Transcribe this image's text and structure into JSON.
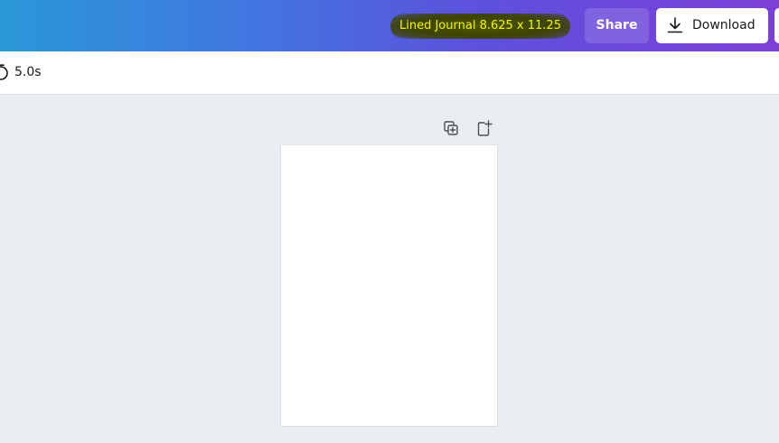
{
  "header": {
    "doc_title": "Lined Journal 8.625 x 11.25",
    "share_label": "Share",
    "download_label": "Download",
    "download_icon": "download-arrow-icon"
  },
  "toolbar": {
    "timer_icon": "timer-icon",
    "timer_value": "5.0s"
  },
  "canvas": {
    "tools": [
      {
        "icon": "duplicate-page-icon"
      },
      {
        "icon": "add-page-icon"
      }
    ]
  },
  "colors": {
    "header_gradient_start": "#2a98d8",
    "header_gradient_end": "#7d3fd8",
    "title_highlight_text": "#f2f500",
    "title_highlight_bg": "#3d4400",
    "canvas_bg": "#ebeef1",
    "page_bg": "#ffffff"
  }
}
